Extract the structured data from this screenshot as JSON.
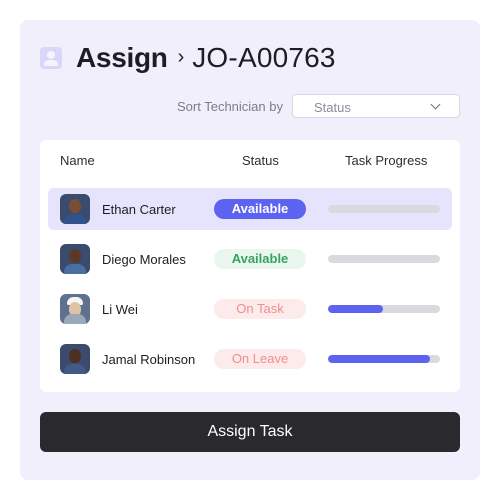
{
  "header": {
    "title": "Assign",
    "job_id": "JO-A00763"
  },
  "sort": {
    "label": "Sort Technician by",
    "value": "Status"
  },
  "table": {
    "columns": [
      "Name",
      "Status",
      "Task Progress"
    ],
    "rows": [
      {
        "name": "Ethan Carter",
        "status": "Available",
        "progress": 0,
        "selected": true
      },
      {
        "name": "Diego Morales",
        "status": "Available",
        "progress": 0,
        "selected": false
      },
      {
        "name": "Li Wei",
        "status": "On Task",
        "progress": 0.49,
        "selected": false
      },
      {
        "name": "Jamal Robinson",
        "status": "On Leave",
        "progress": 0.91,
        "selected": false
      }
    ]
  },
  "colors": {
    "accent": "#5c63f0",
    "available_text": "#37a35f",
    "unavailable_text": "#ee8f8d"
  },
  "footer": {
    "button_label": "Assign Task"
  }
}
